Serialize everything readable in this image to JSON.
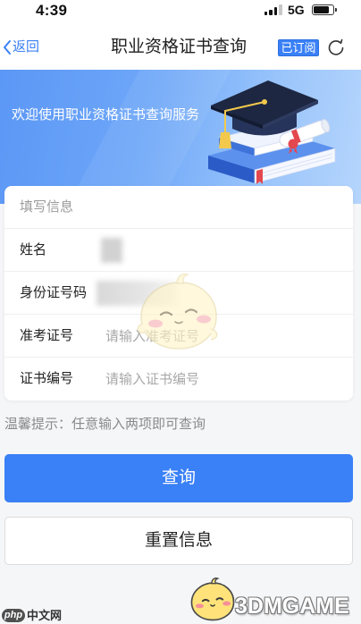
{
  "status_bar": {
    "time": "4:39",
    "network": "5G",
    "signal_strength": 3,
    "signal_max": 4,
    "battery_level": 0.8,
    "icons": {
      "signal": "cellular-signal-icon",
      "battery": "battery-icon"
    }
  },
  "nav": {
    "back_label": "返回",
    "title": "职业资格证书查询",
    "subscribed_label": "已订阅",
    "icons": {
      "back": "chevron-left-icon",
      "refresh": "refresh-icon"
    }
  },
  "banner": {
    "welcome_text": "欢迎使用职业资格证书查询服务",
    "illustration": "graduation-cap-on-books-illustration"
  },
  "form": {
    "section_title": "填写信息",
    "fields": [
      {
        "label": "姓名"
      },
      {
        "label": "身份证号码"
      },
      {
        "label": "准考证号",
        "placeholder": "请输入准考证号"
      },
      {
        "label": "证书编号",
        "placeholder": "请输入证书编号"
      }
    ]
  },
  "hint": "温馨提示：任意输入两项即可查询",
  "actions": {
    "query_label": "查询",
    "reset_label": "重置信息"
  },
  "watermarks": {
    "php_logo": "php",
    "php_site": "中文网",
    "brand": "3DMGAME",
    "mascot": "3dm-mascot-watermark"
  },
  "colors": {
    "primary": "#3a80f6",
    "page_background": "#f5f6f8",
    "text": "#222222",
    "muted_text": "#8a8a8a",
    "placeholder": "#a8a8a8",
    "banner_start": "#5b97f6",
    "banner_end": "#b5d5fc"
  }
}
